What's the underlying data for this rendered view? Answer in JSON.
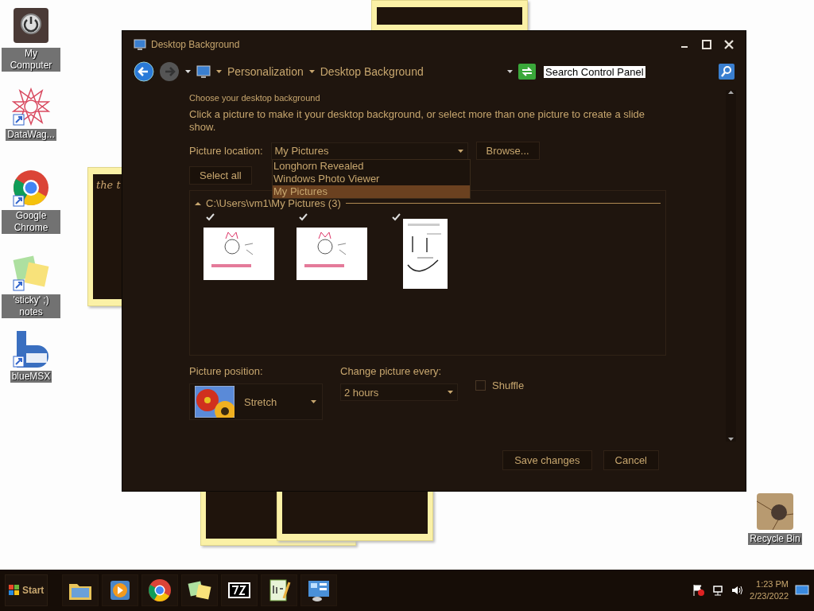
{
  "desktop_icons": [
    {
      "label": "My Computer",
      "kind": "power"
    },
    {
      "label": "DataWag...",
      "kind": "star"
    },
    {
      "label": "Google Chrome",
      "kind": "chrome"
    },
    {
      "label": "'sticky' ;) notes",
      "kind": "sticky"
    },
    {
      "label": "blueMSX",
      "kind": "msx"
    }
  ],
  "recycle_bin": {
    "label": "Recycle Bin"
  },
  "sticky_note": {
    "text": "the t"
  },
  "window": {
    "title": "Desktop Background",
    "breadcrumbs": [
      "Personalization",
      "Desktop Background"
    ],
    "search": {
      "value": "Search Control Panel"
    },
    "heading": "Choose your desktop background",
    "description": "Click a picture to make it your desktop background, or select more than one picture to create a slide show.",
    "picture_location": {
      "label": "Picture location:",
      "value": "My Pictures",
      "expanded": true,
      "options": [
        {
          "label": "Longhorn Revealed",
          "selected": false
        },
        {
          "label": "Windows Photo Viewer",
          "selected": false
        },
        {
          "label": "My Pictures",
          "selected": true
        }
      ]
    },
    "browse_button": "Browse...",
    "select_all_button": "Select all",
    "group": {
      "label": "C:\\Users\\vm1\\My Pictures (3)",
      "expanded": true,
      "pictures": [
        {
          "kind": "picture",
          "checked": true
        },
        {
          "kind": "picture",
          "checked": true
        },
        {
          "kind": "picture",
          "checked": true
        }
      ]
    },
    "picture_position": {
      "label": "Picture position:",
      "value": "Stretch"
    },
    "change_every": {
      "label": "Change picture every:",
      "value": "2 hours"
    },
    "shuffle": {
      "label": "Shuffle",
      "checked": false
    },
    "buttons": [
      "Save changes",
      "Cancel"
    ]
  },
  "taskbar": {
    "start": "Start",
    "apps": [
      {
        "kind": "folder"
      },
      {
        "kind": "media"
      },
      {
        "kind": "chrome"
      },
      {
        "kind": "sticky"
      },
      {
        "kind": "zip"
      },
      {
        "kind": "notepad"
      },
      {
        "kind": "control"
      }
    ],
    "time": "1:23 PM",
    "date": "2/23/2022"
  }
}
